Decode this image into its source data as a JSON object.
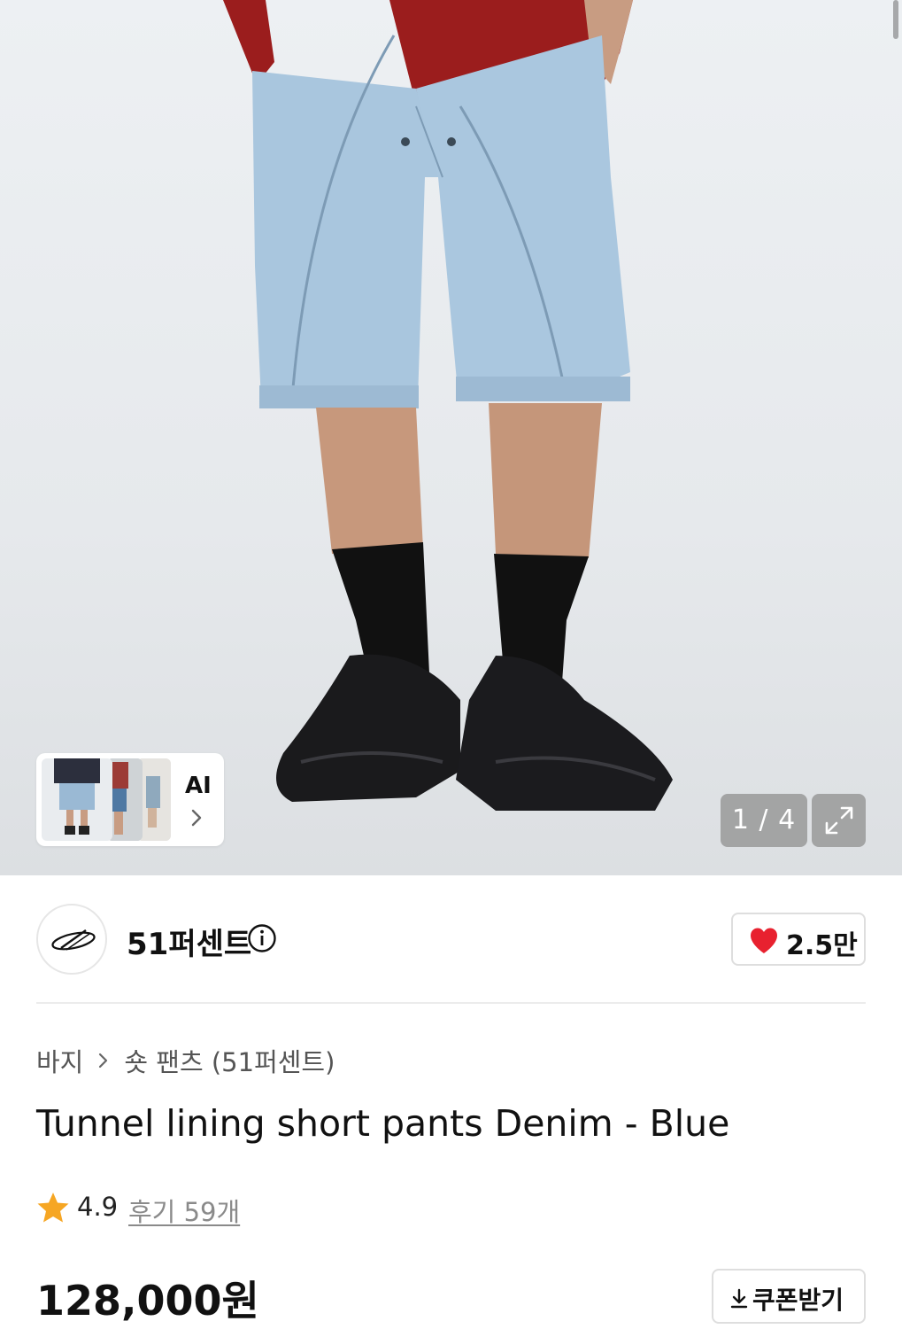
{
  "gallery": {
    "counter": "1 / 4",
    "ai_label": "AI",
    "thumbnails": [
      "product-thumb-front",
      "product-thumb-side",
      "product-thumb-back"
    ]
  },
  "brand": {
    "name": "51퍼센트",
    "likes": "2.5만"
  },
  "breadcrumb": {
    "category": "바지",
    "subcategory": "숏 팬츠 (51퍼센트)"
  },
  "product": {
    "title": "Tunnel lining short pants Denim - Blue",
    "rating": "4.9",
    "reviews": "후기 59개",
    "price": "128,000원",
    "coupon_label": "쿠폰받기"
  },
  "colors": {
    "heart": "#e8212f",
    "star": "#f6a623",
    "denim": "#a9c6de",
    "shirt": "#9b1d1d"
  },
  "icons": [
    "info-icon",
    "heart-icon",
    "star-icon",
    "chevron-right-icon",
    "expand-icon",
    "download-icon",
    "brand-logo-icon"
  ]
}
